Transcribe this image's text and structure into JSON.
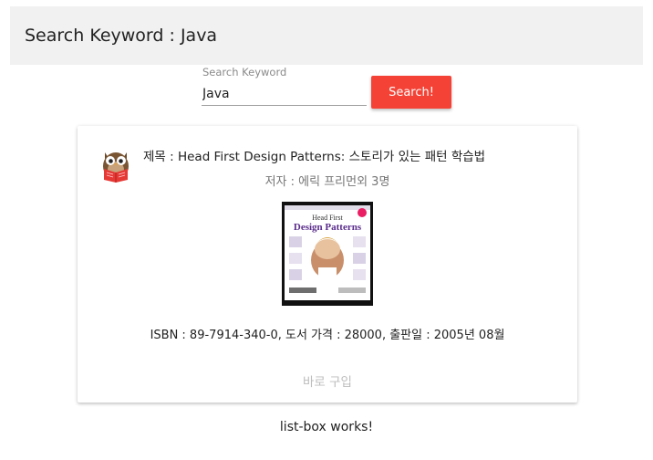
{
  "toolbar": {
    "title": "Search Keyword : Java"
  },
  "search": {
    "label": "Search Keyword",
    "value": "Java",
    "button_label": "Search!"
  },
  "card": {
    "title_line": "제목 : Head First Design Patterns: 스토리가 있는 패턴 학습법",
    "author_line": "저자 : 에릭 프리먼외 3명",
    "cover": {
      "line1": "Head First",
      "line2": "Design Patterns"
    },
    "info_line": "ISBN : 89-7914-340-0, 도서 가격 : 28000, 출판일 : 2005년 08월",
    "buy_label": "바로 구입"
  },
  "footer": {
    "text": "list-box works!"
  },
  "colors": {
    "accent": "#f44336",
    "toolbar_bg": "#f1f1f1",
    "cover_border": "#111111",
    "cover_title": "#5b2d8c"
  },
  "icons": {
    "avatar": "owl-reading-icon"
  }
}
